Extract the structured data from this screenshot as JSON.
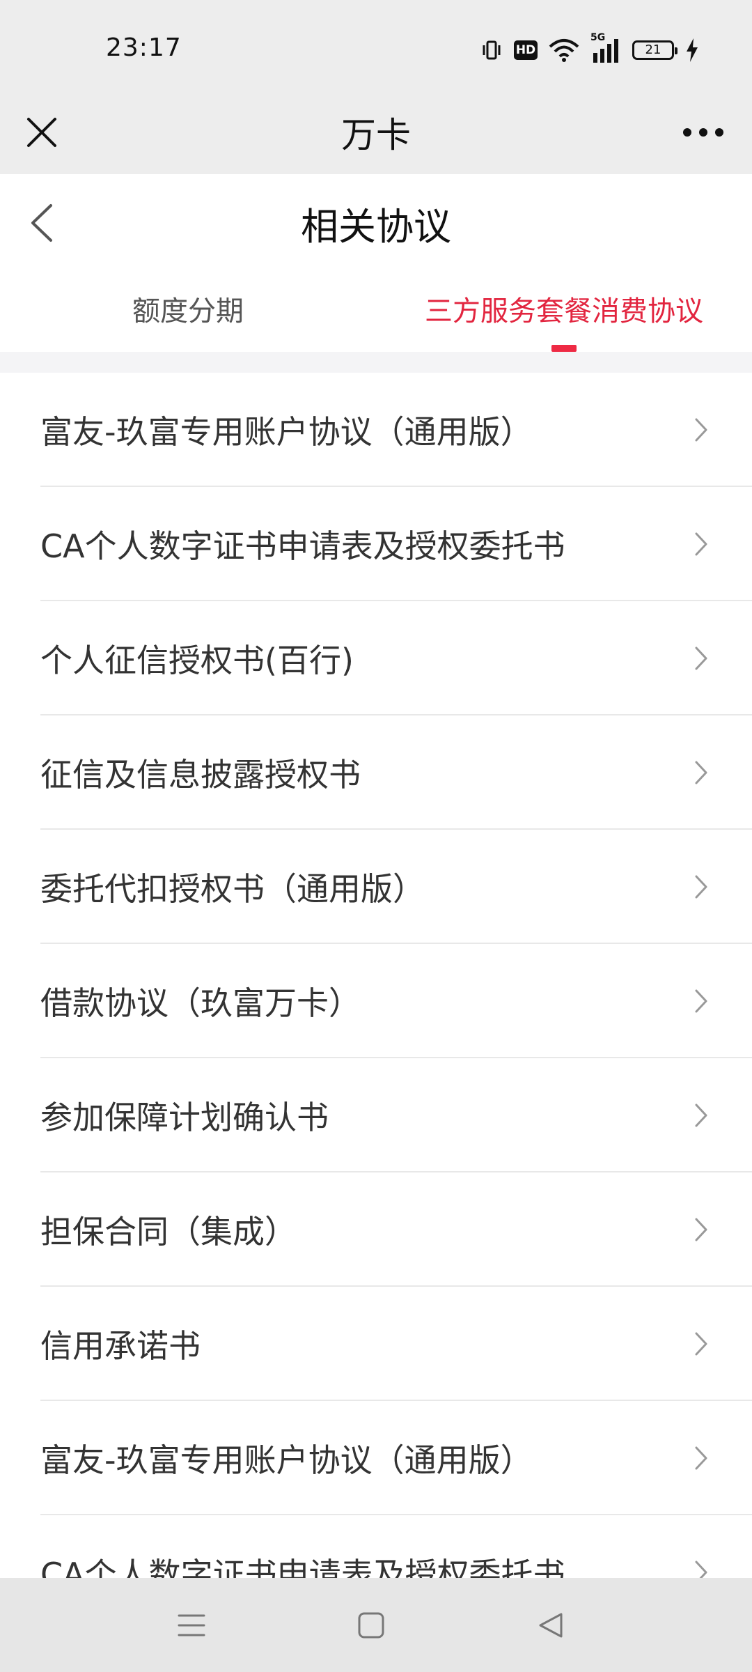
{
  "status_bar": {
    "time": "23:17",
    "hd_label": "HD",
    "network_label": "5G",
    "battery_level": "21",
    "icons": [
      "vibrate-icon",
      "hd-icon",
      "wifi-icon",
      "signal-5g-icon",
      "battery-icon",
      "charging-icon"
    ]
  },
  "mini_program": {
    "title": "万卡",
    "close_icon": "close-icon",
    "more_icon": "more-icon"
  },
  "page": {
    "title": "相关协议",
    "back_icon": "chevron-left-icon"
  },
  "tabs": [
    {
      "label": "额度分期",
      "active": false
    },
    {
      "label": "三方服务套餐消费协议",
      "active": true
    }
  ],
  "colors": {
    "accent": "#e2253f",
    "indicator": "#ee2a44",
    "header_bg": "#ededed",
    "text": "#333333"
  },
  "agreements": [
    {
      "label": "富友-玖富专用账户协议（通用版）"
    },
    {
      "label": "CA个人数字证书申请表及授权委托书"
    },
    {
      "label": "个人征信授权书(百行)"
    },
    {
      "label": "征信及信息披露授权书"
    },
    {
      "label": "委托代扣授权书（通用版）"
    },
    {
      "label": "借款协议（玖富万卡）"
    },
    {
      "label": "参加保障计划确认书"
    },
    {
      "label": "担保合同（集成）"
    },
    {
      "label": "信用承诺书"
    },
    {
      "label": "富友-玖富专用账户协议（通用版）"
    },
    {
      "label": "CA个人数字证书申请表及授权委托书"
    }
  ],
  "nav_bar": {
    "icons": [
      "menu-icon",
      "home-icon",
      "back-icon"
    ]
  }
}
